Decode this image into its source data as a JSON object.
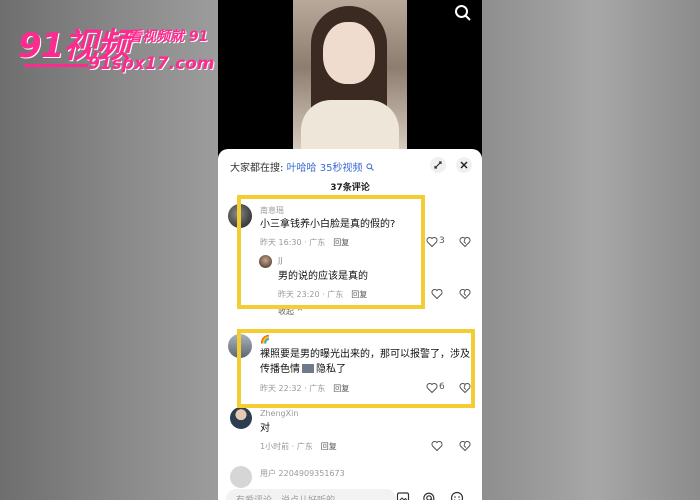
{
  "watermark": {
    "logo": "91视频",
    "tag": "看视频就 91",
    "url": "91spx17.com"
  },
  "search_bar": {
    "prefix": "大家都在搜:",
    "keyword": "叶哈哈 35秒视频"
  },
  "comments_count": "37条评论",
  "comments": [
    {
      "username": "南息瑶",
      "text": "小三拿钱养小白脸是真的假的?",
      "time": "昨天 16:30 · 广东",
      "reply_label": "回复",
      "likes": "3"
    },
    {
      "username": "JJ",
      "text": "男的说的应该是真的",
      "time": "昨天 23:20 · 广东",
      "reply_label": "回复"
    },
    {
      "collapse_label": "收起"
    },
    {
      "username": "",
      "text_line1": "裸照要是男的曝光出来的，那可以报警了，涉及",
      "text_line2": "传播色情",
      "text_line2_end": "隐私了",
      "time": "昨天 22:32 · 广东",
      "reply_label": "回复",
      "likes": "6"
    },
    {
      "username": "ZhengXin",
      "text": "对",
      "time": "1小时前 · 广东",
      "reply_label": "回复"
    },
    {
      "username": "用户 2204909351673"
    }
  ],
  "input": {
    "placeholder": "有爱评论，说点儿好听的"
  },
  "icons": [
    "search-icon",
    "expand-icon",
    "close-icon",
    "heart-icon",
    "dislike-icon",
    "image-icon",
    "at-icon",
    "emoji-icon"
  ],
  "colors": {
    "highlight": "#f4cc34",
    "link": "#3b6bd6",
    "watermark": "#ff2a8f"
  }
}
